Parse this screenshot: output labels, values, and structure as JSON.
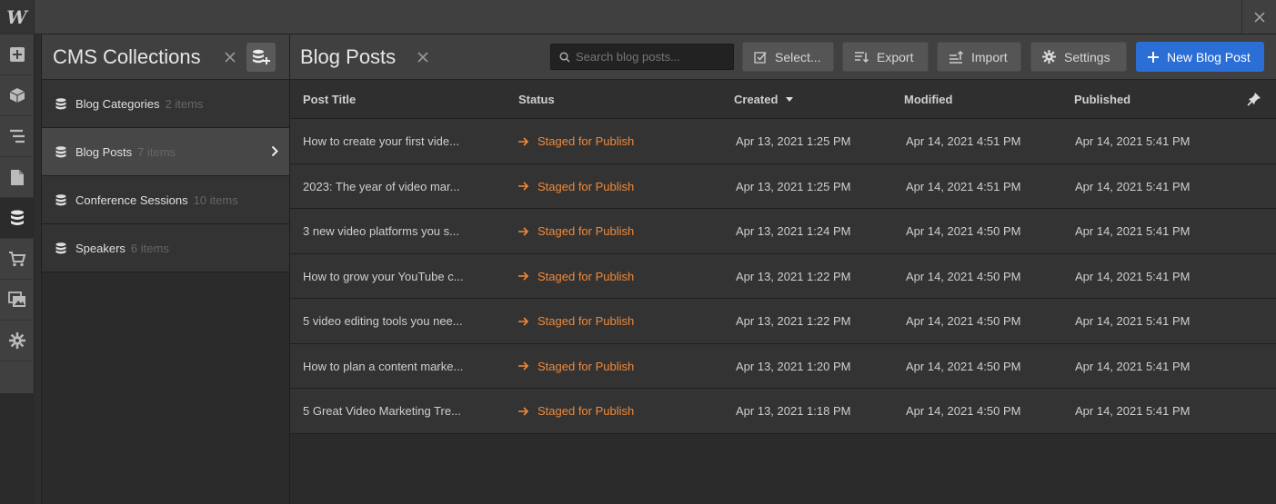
{
  "app": {
    "logo": "W",
    "accent": "#2a6ed6",
    "status_color": "#f0893a"
  },
  "rail": {
    "items": [
      "add-icon",
      "cube-icon",
      "navigator-icon",
      "pages-icon",
      "cms-icon",
      "ecommerce-icon",
      "assets-icon",
      "settings-icon"
    ],
    "active": "cms-icon"
  },
  "collections": {
    "title": "CMS Collections",
    "items": [
      {
        "name": "Blog Categories",
        "count": "2 items"
      },
      {
        "name": "Blog Posts",
        "count": "7 items"
      },
      {
        "name": "Conference Sessions",
        "count": "10 items"
      },
      {
        "name": "Speakers",
        "count": "6 items"
      }
    ],
    "active_index": 1
  },
  "main": {
    "title": "Blog Posts",
    "search_placeholder": "Search blog posts...",
    "select_label": "Select...",
    "export_label": "Export",
    "import_label": "Import",
    "settings_label": "Settings",
    "new_label": "New Blog Post"
  },
  "table": {
    "columns": [
      "Post Title",
      "Status",
      "Created",
      "Modified",
      "Published"
    ],
    "sort_column": "Created",
    "rows": [
      {
        "title": "How to create your first vide...",
        "status": "Staged for Publish",
        "created": "Apr 13, 2021 1:25 PM",
        "modified": "Apr 14, 2021 4:51 PM",
        "published": "Apr 14, 2021 5:41 PM"
      },
      {
        "title": "2023: The year of video mar...",
        "status": "Staged for Publish",
        "created": "Apr 13, 2021 1:25 PM",
        "modified": "Apr 14, 2021 4:51 PM",
        "published": "Apr 14, 2021 5:41 PM"
      },
      {
        "title": "3 new video platforms you s...",
        "status": "Staged for Publish",
        "created": "Apr 13, 2021 1:24 PM",
        "modified": "Apr 14, 2021 4:50 PM",
        "published": "Apr 14, 2021 5:41 PM"
      },
      {
        "title": "How to grow your YouTube c...",
        "status": "Staged for Publish",
        "created": "Apr 13, 2021 1:22 PM",
        "modified": "Apr 14, 2021 4:50 PM",
        "published": "Apr 14, 2021 5:41 PM"
      },
      {
        "title": "5 video editing tools you nee...",
        "status": "Staged for Publish",
        "created": "Apr 13, 2021 1:22 PM",
        "modified": "Apr 14, 2021 4:50 PM",
        "published": "Apr 14, 2021 5:41 PM"
      },
      {
        "title": "How to plan a content marke...",
        "status": "Staged for Publish",
        "created": "Apr 13, 2021 1:20 PM",
        "modified": "Apr 14, 2021 4:50 PM",
        "published": "Apr 14, 2021 5:41 PM"
      },
      {
        "title": "5 Great Video Marketing Tre...",
        "status": "Staged for Publish",
        "created": "Apr 13, 2021 1:18 PM",
        "modified": "Apr 14, 2021 4:50 PM",
        "published": "Apr 14, 2021 5:41 PM"
      }
    ]
  }
}
